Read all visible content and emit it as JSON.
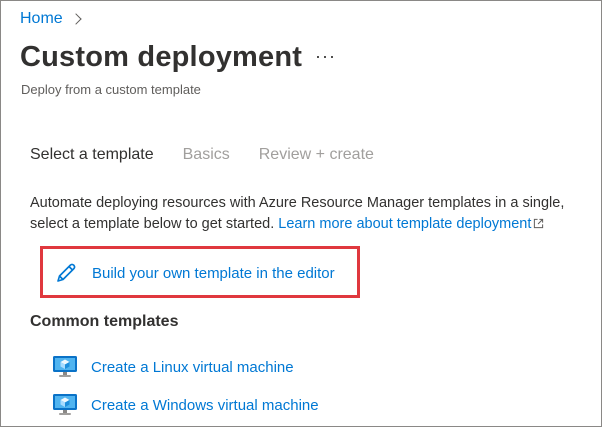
{
  "breadcrumb": {
    "home": "Home"
  },
  "header": {
    "title": "Custom deployment",
    "more": "···",
    "subtitle": "Deploy from a custom template"
  },
  "tabs": [
    {
      "label": "Select a template",
      "active": true
    },
    {
      "label": "Basics",
      "active": false
    },
    {
      "label": "Review + create",
      "active": false
    }
  ],
  "description": {
    "line1": "Automate deploying resources with Azure Resource Manager templates in a single,",
    "line2": "select a template below to get started.",
    "link": "Learn more about template deployment"
  },
  "build_template": {
    "label": "Build your own template in the editor",
    "icon": "pencil-icon",
    "highlight_color": "#e0383e"
  },
  "common": {
    "heading": "Common templates",
    "items": [
      {
        "label": "Create a Linux virtual machine",
        "icon": "virtual-machine-icon"
      },
      {
        "label": "Create a Windows virtual machine",
        "icon": "virtual-machine-icon"
      }
    ]
  },
  "colors": {
    "link": "#0078d4",
    "text": "#323130",
    "muted": "#a19f9d"
  }
}
